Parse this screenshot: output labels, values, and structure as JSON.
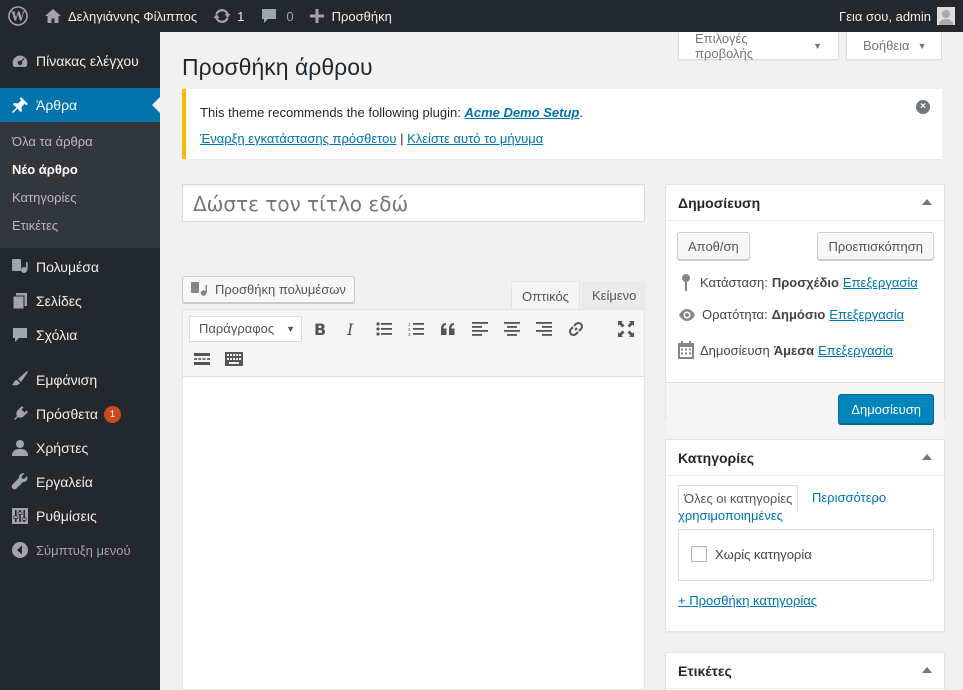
{
  "adminbar": {
    "site_name": "Δεληγιάννης Φίλιππος",
    "updates_count": "1",
    "comments_count": "0",
    "new_label": "Προσθήκη",
    "greeting": "Γεια σου, admin"
  },
  "sidebar": {
    "dashboard": "Πίνακας ελέγχου",
    "posts": "Άρθρα",
    "submenu": [
      "Όλα τα άρθρα",
      "Νέο άρθρο",
      "Κατηγορίες",
      "Ετικέτες"
    ],
    "media": "Πολυμέσα",
    "pages": "Σελίδες",
    "comments": "Σχόλια",
    "appearance": "Εμφάνιση",
    "plugins": "Πρόσθετα",
    "plugins_badge": "1",
    "users": "Χρήστες",
    "tools": "Εργαλεία",
    "settings": "Ρυθμίσεις",
    "collapse": "Σύμπτυξη μενού"
  },
  "screen_meta": {
    "screen_options": "Επιλογές προβολής",
    "help": "Βοήθεια"
  },
  "page_title": "Προσθήκη άρθρου",
  "notice": {
    "text": "This theme recommends the following plugin: ",
    "plugin": "Acme Demo Setup",
    "period": ".",
    "install_link": "Έναρξη εγκατάστασης πρόσθετου",
    "separator": "|",
    "dismiss_link": "Κλείστε αυτό το μήνυμα"
  },
  "title_placeholder": "Δώστε τον τίτλο εδώ",
  "editor": {
    "add_media": "Προσθήκη πολυμέσων",
    "tab_visual": "Οπτικός",
    "tab_text": "Κείμενο",
    "format": "Παράγραφος"
  },
  "publish_box": {
    "title": "Δημοσίευση",
    "save_draft": "Αποθ/ση",
    "preview": "Προεπισκόπηση",
    "status_label": "Κατάσταση:",
    "status_value": "Προσχέδιο",
    "visibility_label": "Ορατότητα:",
    "visibility_value": "Δημόσιο",
    "schedule_label": "Δημοσίευση",
    "schedule_value": "Άμεσα",
    "edit_link": "Επεξεργασία",
    "publish_button": "Δημοσίευση"
  },
  "categories_box": {
    "title": "Κατηγορίες",
    "tab_all": "Όλες οι κατηγορίες",
    "tab_popular": "Περισσότερο χρησιμοποιημένες",
    "items": [
      "Χωρίς κατηγορία"
    ],
    "add_new": "+ Προσθήκη κατηγορίας"
  },
  "tags_box": {
    "title": "Ετικέτες"
  },
  "colors": {
    "admin_bar": "#23282d",
    "active_menu": "#0073aa",
    "publish_button": "#0085ba",
    "notice_border": "#ffb900"
  }
}
